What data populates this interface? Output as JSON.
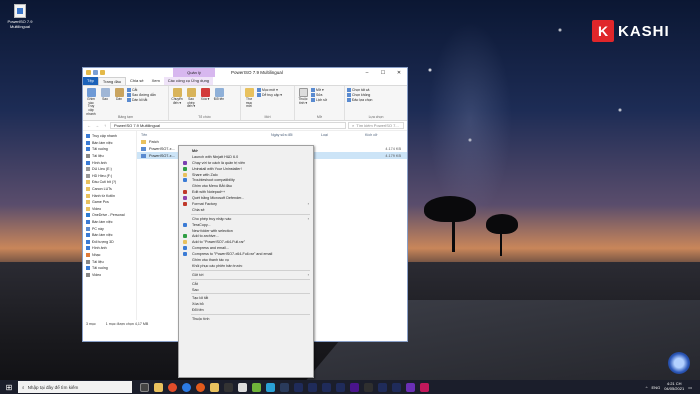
{
  "desktop": {
    "icon_label": "PowerISO 7.9 Multilingual"
  },
  "logo": {
    "letter": "K",
    "text": "KASHI"
  },
  "window": {
    "title": "PowerISO 7.9 Multilingual",
    "manage_tab": "Quản lý",
    "tabs": [
      "Tệp",
      "Trang đầu",
      "Chia sẻ",
      "Xem",
      "Các công cụ Ứng dụng"
    ],
    "ribbon": {
      "pin": "Ghim vào Truy cập nhanh",
      "copy": "Sao",
      "paste": "Dán",
      "cut": "Cắt",
      "copy_path": "Sao đường dẫn",
      "paste_shortcut": "Dán lối tắt",
      "move_to": "Chuyển đến ▾",
      "copy_to": "Sao chép đến ▾",
      "delete": "Xóa ▾",
      "rename": "Đổi tên",
      "new_folder": "Thư mục mới",
      "new_item": "Mục mới ▾",
      "easy_access": "Dễ truy cập ▾",
      "properties": "Thuộc tính ▾",
      "open": "Mở ▾",
      "edit": "Sửa",
      "history": "Lịch sử",
      "select_all": "Chọn tất cả",
      "select_none": "Chọn không",
      "invert": "Đảo lựa chọn",
      "group_clipboard": "Bảng tạm",
      "group_organize": "Tổ chức",
      "group_new": "Mới",
      "group_open": "Mở",
      "group_select": "Lựa chọn"
    },
    "address": "PowerISO 7.9 Multilingual",
    "search_placeholder": "Tìm kiếm PowerISO 7...",
    "columns": {
      "name": "Tên",
      "date": "Ngày sửa đổi",
      "type": "Loại",
      "size": "Kích cỡ"
    },
    "files": [
      {
        "name": "Patch",
        "size": ""
      },
      {
        "name": "PowerISO7-x...",
        "size": "4.174 KB"
      },
      {
        "name": "PowerISO7-x...",
        "size": "4.179 KB"
      }
    ],
    "nav": [
      "Truy cập nhanh",
      "Bàn làm việc",
      "Tải xuống",
      "Tài liệu",
      "Hình ảnh",
      "DU Lieu (E:)",
      "HD Hieu (F:)",
      "Đầu Cuti bit (?)",
      "Canon LUTs",
      "Hành từ Kotlin",
      "Game Pcs",
      "Video",
      "OneDrive - Personal",
      "Bàn làm việc",
      "PC này",
      "Bàn làm việc",
      "Đối tượng 3D",
      "Hình ảnh",
      "Nhạc",
      "Tài liệu",
      "Tải xuống",
      "Video"
    ],
    "status": {
      "count": "3 mục",
      "selected": "1 mục được chọn  4,17 MB"
    }
  },
  "context_menu": [
    {
      "label": "Mở",
      "bold": true
    },
    {
      "label": "Launch with Ninjatt H&D 6.0"
    },
    {
      "label": "Chạy với tư cách là quản trị viên"
    },
    {
      "label": "Uninstall with Your Uninstaller!"
    },
    {
      "label": "Share with Zalo"
    },
    {
      "label": "Troubleshoot compatibility"
    },
    {
      "label": "Ghim vào Menu Bắt đầu"
    },
    {
      "label": "Edit with Notepad++"
    },
    {
      "label": "Quét bằng Microsoft Defender..."
    },
    {
      "label": "Format Factory",
      "arrow": true
    },
    {
      "label": "Chia sẻ"
    },
    {
      "sep": true
    },
    {
      "label": "Cho phép truy nhập vào",
      "arrow": true
    },
    {
      "label": "TeraCopy..."
    },
    {
      "label": "New folder with selection"
    },
    {
      "label": "Add to archive..."
    },
    {
      "label": "Add to \"PowerISO7-x64-Full.rar\""
    },
    {
      "label": "Compress and email..."
    },
    {
      "label": "Compress to \"PowerISO7-x64-Full.rar\" and email"
    },
    {
      "label": "Ghim vào thanh tác vụ"
    },
    {
      "label": "Khôi phục các phiên bản trước"
    },
    {
      "sep": true
    },
    {
      "label": "Gửi tới",
      "arrow": true
    },
    {
      "sep": true
    },
    {
      "label": "Cắt"
    },
    {
      "label": "Sao"
    },
    {
      "sep": true
    },
    {
      "label": "Tạo lối tắt"
    },
    {
      "label": "Xóa bỏ"
    },
    {
      "label": "Đổi tên"
    },
    {
      "sep": true
    },
    {
      "label": "Thuộc tính"
    }
  ],
  "taskbar": {
    "search_placeholder": "Nhập tại đây để tìm kiếm",
    "time": "4:21 CH",
    "date": "04/05/2021",
    "language": "ENG"
  }
}
